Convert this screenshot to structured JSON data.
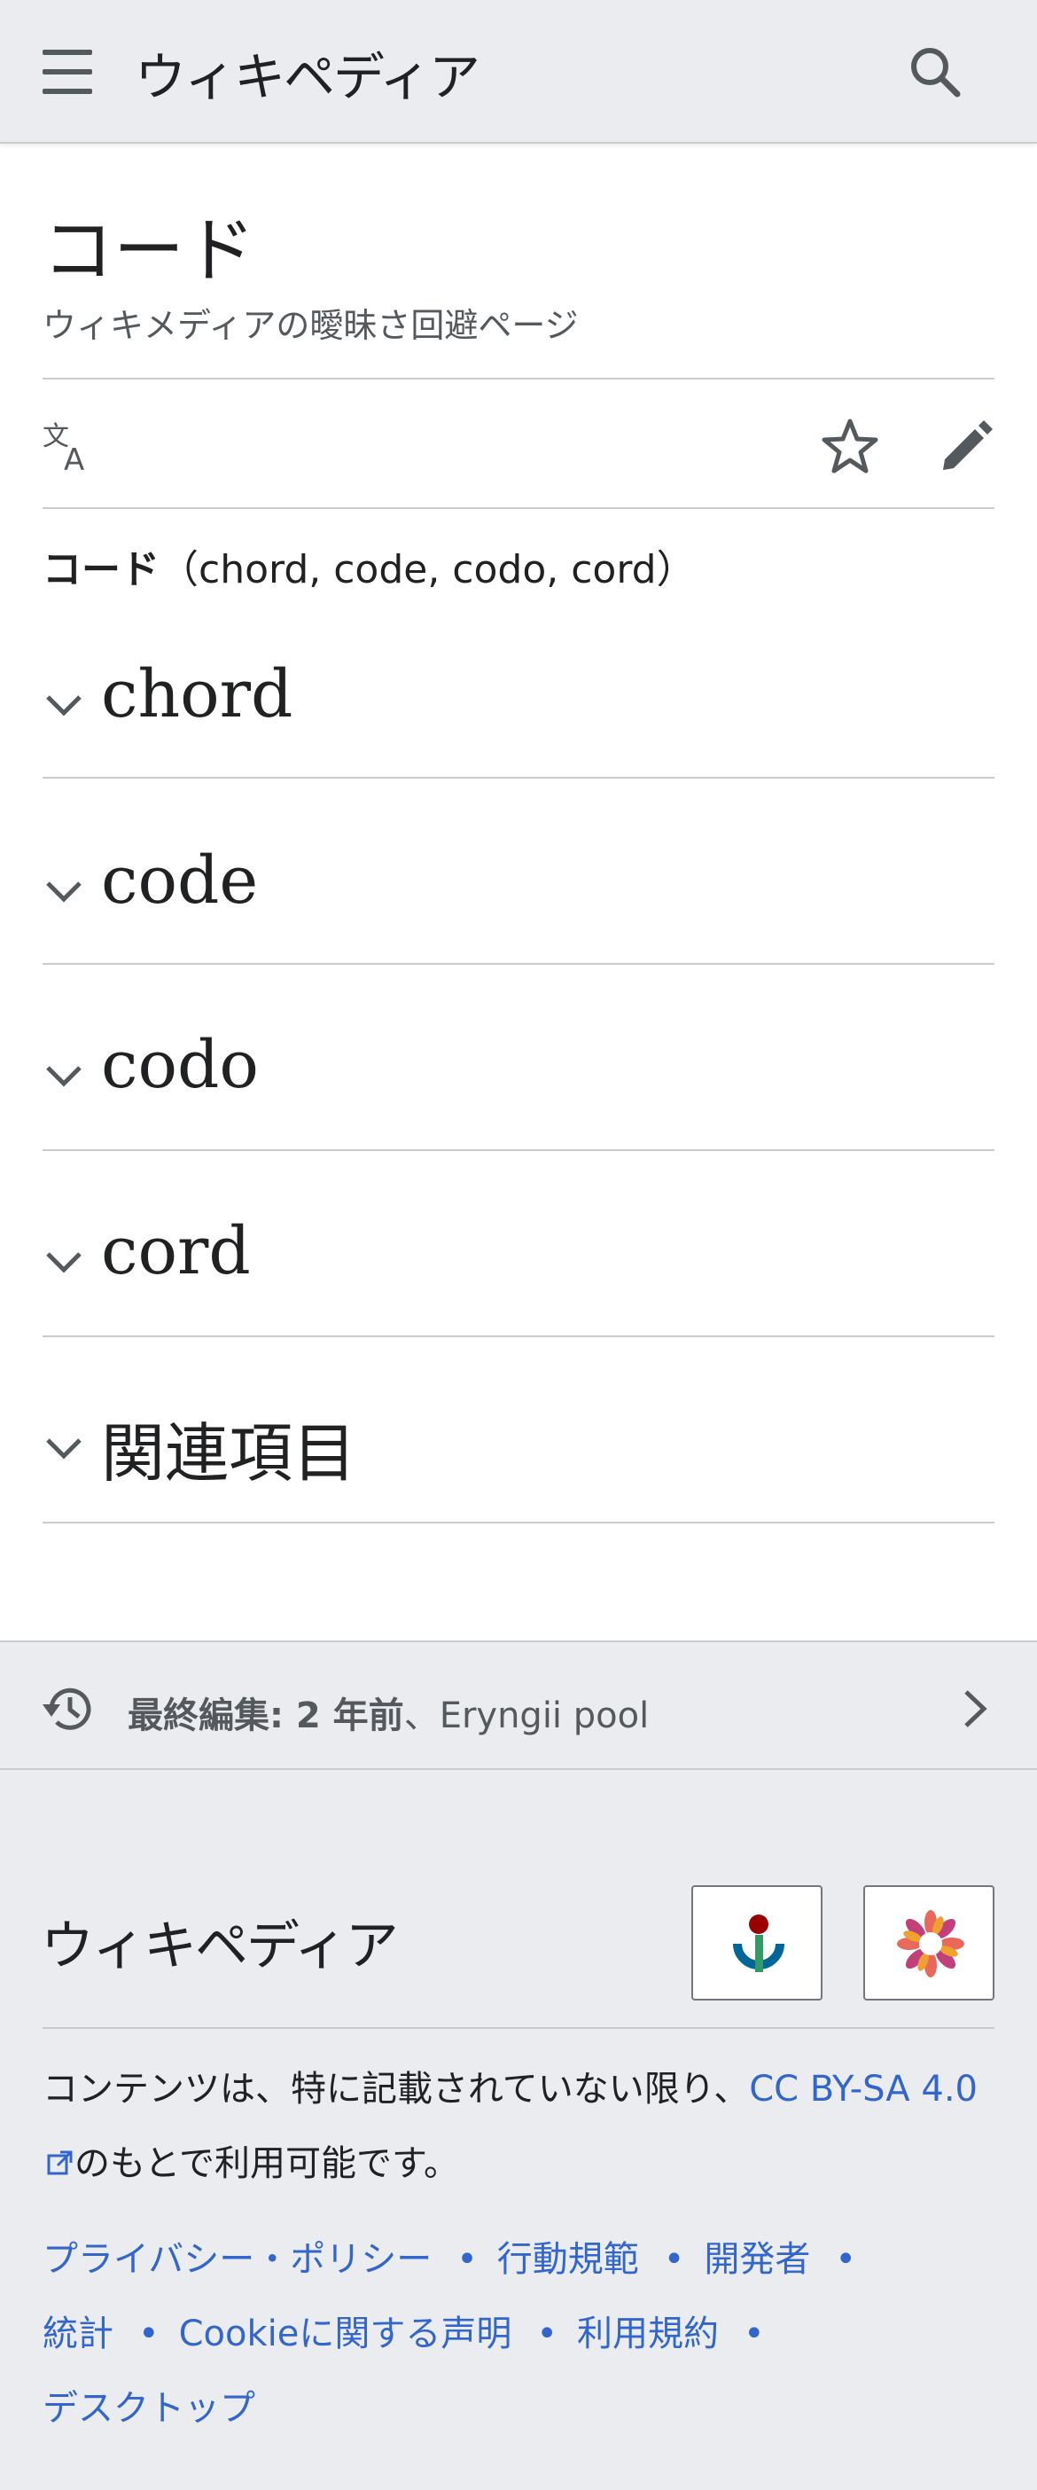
{
  "header": {
    "wordmark": "ウィキペディア",
    "menu_icon": "hamburger-menu-icon",
    "search_icon": "search-icon"
  },
  "article": {
    "title": "コード",
    "subtitle": "ウィキメディアの曖昧さ回避ページ",
    "actions": {
      "language_icon": "language-icon",
      "watch_icon": "star-icon",
      "edit_icon": "pencil-icon"
    },
    "lead_bold": "コード",
    "lead_rest": "（chord, code, codo, cord）",
    "sections": [
      {
        "title": "chord"
      },
      {
        "title": "code"
      },
      {
        "title": "codo"
      },
      {
        "title": "cord"
      },
      {
        "title": "関連項目"
      }
    ]
  },
  "last_edited": {
    "label": "最終編集: 2 年前",
    "separator": "、",
    "user": "Eryngii pool"
  },
  "footer": {
    "wordmark": "ウィキペディア",
    "badges": [
      "wikimedia-foundation-logo",
      "mediawiki-logo"
    ],
    "license_prefix": "コンテンツは、特に記載されていない限り、",
    "license_link": "CC BY-SA 4.0",
    "license_suffix": "のもとで利用可能です。",
    "links": [
      "プライバシー・ポリシー",
      "行動規範",
      "開発者",
      "統計",
      "Cookieに関する声明",
      "利用規約",
      "デスクトップ"
    ],
    "link_separator": "•"
  },
  "colors": {
    "header_bg": "#eaecf0",
    "link": "#3366cc",
    "text": "#202122",
    "subtle_text": "#54595d",
    "divider": "#c8ccd1"
  }
}
